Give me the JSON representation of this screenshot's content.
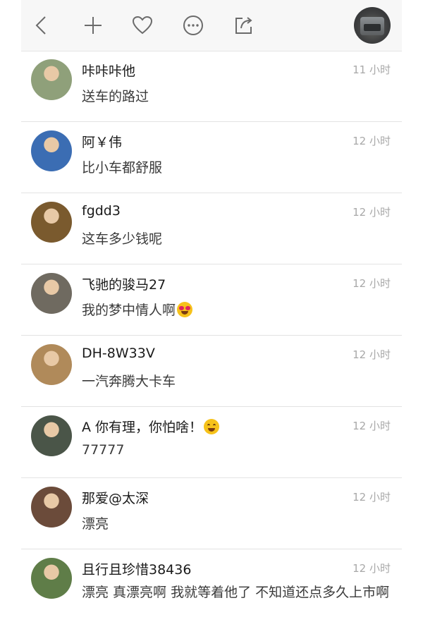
{
  "toolbar": {
    "icons": [
      "back-icon",
      "plus-icon",
      "heart-icon",
      "more-icon",
      "share-icon"
    ]
  },
  "comments": [
    {
      "name": "咔咔咔他",
      "time": "11 小时",
      "text": "送车的路过",
      "avatar_color": "#8fa07a"
    },
    {
      "name": "阿￥伟",
      "time": "12 小时",
      "text": "比小车都舒服",
      "avatar_color": "#3b6db3"
    },
    {
      "name": "fgdd3",
      "time": "12 小时",
      "text": "这车多少钱呢",
      "avatar_color": "#7a5a2e"
    },
    {
      "name": "飞驰的骏马27",
      "time": "12 小时",
      "text": "我的梦中情人啊",
      "avatar_color": "#6f6a60",
      "emoji": "heart-eyes-emoji"
    },
    {
      "name": "DH-8W33V",
      "time": "12 小时",
      "text": "一汽奔腾大卡车",
      "avatar_color": "#b08a5a"
    },
    {
      "name": "A  你有理，你怕啥！",
      "time": "12 小时",
      "text": "77777",
      "avatar_color": "#4a5548",
      "emoji": "grin-emoji"
    },
    {
      "name": "那爱@太深",
      "time": "12 小时",
      "text": "漂亮",
      "avatar_color": "#6b4b3a"
    },
    {
      "name": "且行且珍惜38436",
      "time": "12 小时",
      "text": "漂亮 真漂亮啊 我就等着他了 不知道还点多久上市啊",
      "avatar_color": "#5f7d48"
    }
  ]
}
